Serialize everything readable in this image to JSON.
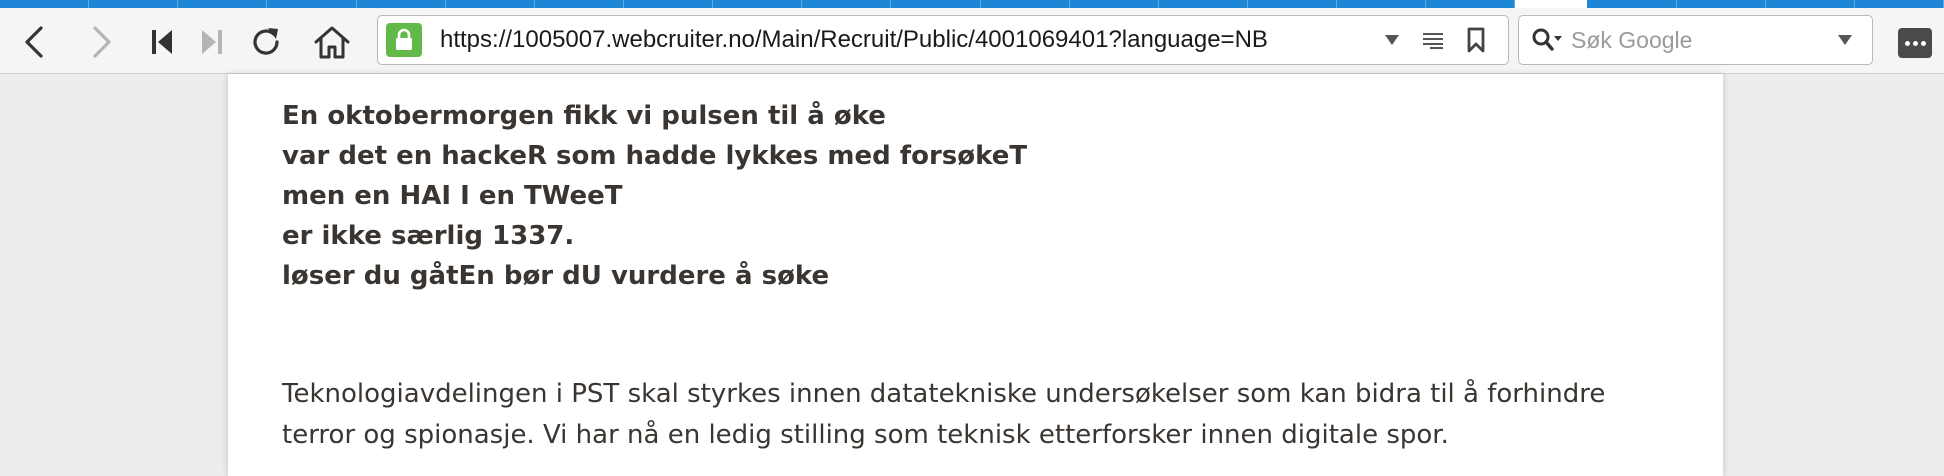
{
  "browser": {
    "url": "https://1005007.webcruiter.no/Main/Recruit/Public/4001069401?language=NB",
    "search_placeholder": "Søk Google",
    "icons": {
      "back": "back-arrow-icon",
      "forward": "forward-arrow-icon",
      "first": "skip-back-icon",
      "last": "skip-forward-icon",
      "reload": "reload-icon",
      "home": "home-icon",
      "lock": "lock-icon",
      "dropdown": "chevron-down-icon",
      "reader": "reader-view-icon",
      "bookmark": "bookmark-icon",
      "search": "search-icon",
      "menu": "more-menu-icon"
    },
    "colors": {
      "tab_accent": "#1e86d6",
      "secure": "#62b94a"
    }
  },
  "page": {
    "poem_lines": [
      "En oktobermorgen fikk vi pulsen til å øke",
      "var det en hackeR som hadde lykkes med forsøkeT",
      "men en HAI I en TWeeT",
      "er ikke særlig 1337.",
      "løser du gåtEn bør dU vurdere å søke"
    ],
    "paragraph_lines": [
      "Teknologiavdelingen i PST skal styrkes innen datatekniske undersøkelser som kan bidra til å forhindre",
      "terror og spionasje. Vi har nå en ledig stilling som teknisk etterforsker innen digitale spor."
    ]
  }
}
